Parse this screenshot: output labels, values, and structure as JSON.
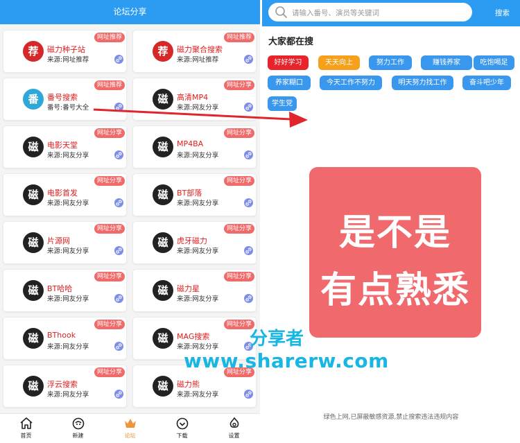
{
  "left": {
    "title": "论坛分享",
    "cards": [
      {
        "name": "磁力种子站",
        "source": "来源:网址推荐",
        "tag": "网址推荐",
        "logo_char": "荐",
        "logo_color": "#d62828"
      },
      {
        "name": "磁力聚合搜索",
        "source": "来源:网址推荐",
        "tag": "网址推荐",
        "logo_char": "荐",
        "logo_color": "#d62828"
      },
      {
        "name": "番号搜索",
        "source": "番号:番号大全",
        "tag": "网址推荐",
        "logo_char": "番",
        "logo_color": "#2ea8d6"
      },
      {
        "name": "高清MP4",
        "source": "来源:网友分享",
        "tag": "网址分享",
        "logo_char": "磁",
        "logo_color": "#222222"
      },
      {
        "name": "电影天堂",
        "source": "来源:网友分享",
        "tag": "网址分享",
        "logo_char": "磁",
        "logo_color": "#222222"
      },
      {
        "name": "MP4BA",
        "source": "来源:网友分享",
        "tag": "网址分享",
        "logo_char": "磁",
        "logo_color": "#222222"
      },
      {
        "name": "电影首发",
        "source": "来源:网友分享",
        "tag": "网址分享",
        "logo_char": "磁",
        "logo_color": "#222222"
      },
      {
        "name": "BT部落",
        "source": "来源:网友分享",
        "tag": "网址分享",
        "logo_char": "磁",
        "logo_color": "#222222"
      },
      {
        "name": "片源网",
        "source": "来源:网友分享",
        "tag": "网址分享",
        "logo_char": "磁",
        "logo_color": "#222222"
      },
      {
        "name": "虎牙磁力",
        "source": "来源:网友分享",
        "tag": "网址分享",
        "logo_char": "磁",
        "logo_color": "#222222"
      },
      {
        "name": "BT哈哈",
        "source": "来源:网友分享",
        "tag": "网址分享",
        "logo_char": "磁",
        "logo_color": "#222222"
      },
      {
        "name": "磁力星",
        "source": "来源:网友分享",
        "tag": "网址分享",
        "logo_char": "磁",
        "logo_color": "#222222"
      },
      {
        "name": "BThook",
        "source": "来源:网友分享",
        "tag": "网址分享",
        "logo_char": "磁",
        "logo_color": "#222222"
      },
      {
        "name": "MAG搜索",
        "source": "来源:网友分享",
        "tag": "网址分享",
        "logo_char": "磁",
        "logo_color": "#222222"
      },
      {
        "name": "浮云搜索",
        "source": "来源:网友分享",
        "tag": "网址分享",
        "logo_char": "磁",
        "logo_color": "#222222"
      },
      {
        "name": "磁力熊",
        "source": "来源:网友分享",
        "tag": "网址分享",
        "logo_char": "磁",
        "logo_color": "#222222"
      }
    ],
    "tabs": [
      {
        "label": "首页",
        "icon": "home-icon"
      },
      {
        "label": "新建",
        "icon": "new-icon"
      },
      {
        "label": "论坛",
        "icon": "crown-icon",
        "active": true
      },
      {
        "label": "下载",
        "icon": "download-icon"
      },
      {
        "label": "设置",
        "icon": "settings-icon"
      }
    ]
  },
  "right": {
    "search_placeholder": "请输入番号、演员等关键词",
    "search_button": "搜索",
    "hot_title": "大家都在搜",
    "chips": [
      {
        "label": "好好学习",
        "color": "#e8232a"
      },
      {
        "label": "天天向上",
        "color": "#f5a11c"
      },
      {
        "label": "努力工作",
        "color": "#3a97ee"
      },
      {
        "label": "赚钱养家",
        "color": "#3a97ee"
      },
      {
        "label": "吃饱喝足",
        "color": "#3a97ee"
      },
      {
        "label": "养家糊口",
        "color": "#3a97ee"
      },
      {
        "label": "今天工作不努力",
        "color": "#3a97ee"
      },
      {
        "label": "明天努力找工作",
        "color": "#3a97ee"
      },
      {
        "label": "奋斗吧少年",
        "color": "#3a97ee"
      },
      {
        "label": "学生党",
        "color": "#3a97ee"
      }
    ],
    "big_text_line1": "是不是",
    "big_text_line2": "有点熟悉",
    "footer_note": "绿色上网,已屏蔽敏感资源,禁止搜索违法违规内容"
  },
  "watermark": {
    "line1": "分享者",
    "line2": "www.sharerw.com"
  },
  "colors": {
    "primary": "#2b9cf2",
    "tag_red": "#f16a6a",
    "big_card": "#f0696d",
    "watermark": "#17b6e3"
  }
}
